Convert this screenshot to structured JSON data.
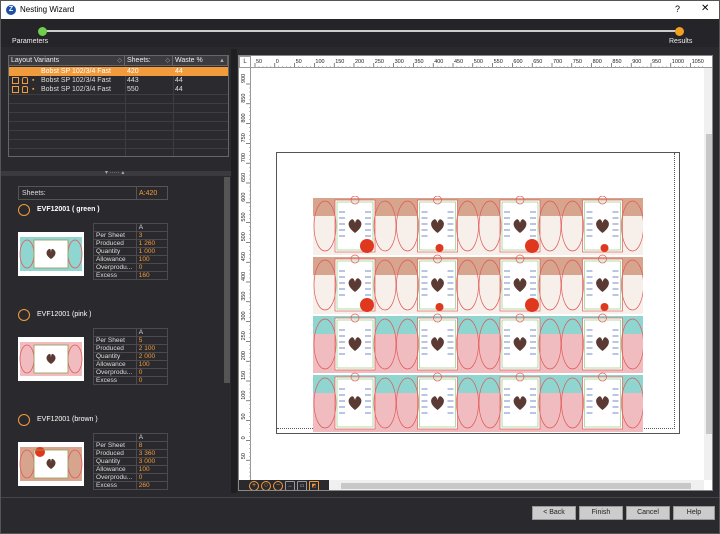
{
  "window": {
    "title": "Nesting Wizard",
    "help": "?",
    "close": "✕"
  },
  "steps": [
    {
      "label": "Parameters",
      "color": "#6ecf4c"
    },
    {
      "label": "Results",
      "color": "#f2a01f"
    }
  ],
  "variants": {
    "columns": [
      "Layout Variants",
      "Sheets:",
      "Waste %"
    ],
    "rows": [
      {
        "name": "Bobst SP 102/3/4 Fast",
        "sheets": "420",
        "waste": "44",
        "selected": true
      },
      {
        "name": "Bobst SP 102/3/4 Fast",
        "sheets": "443",
        "waste": "44",
        "selected": false
      },
      {
        "name": "Bobst SP 102/3/4 Fast",
        "sheets": "550",
        "waste": "44",
        "selected": false
      }
    ]
  },
  "details": {
    "sheets_label": "Sheets:",
    "sheets_value": "A:420",
    "jobs": [
      {
        "name": "EVF12001 ( green )",
        "bold": true,
        "column": "A",
        "stats": [
          [
            "Per Sheet",
            "3"
          ],
          [
            "Produced",
            "1 260"
          ],
          [
            "Quantity",
            "1 000"
          ],
          [
            "Allowance",
            "100"
          ],
          [
            "Overprodu...",
            "0"
          ],
          [
            "Excess",
            "160"
          ]
        ]
      },
      {
        "name": "EVF12001 (pink )",
        "bold": false,
        "column": "A",
        "stats": [
          [
            "Per Sheet",
            "5"
          ],
          [
            "Produced",
            "2 100"
          ],
          [
            "Quantity",
            "2 000"
          ],
          [
            "Allowance",
            "100"
          ],
          [
            "Overprodu...",
            "0"
          ],
          [
            "Excess",
            "0"
          ]
        ]
      },
      {
        "name": "EVF12001 (brown )",
        "bold": false,
        "column": "A",
        "stats": [
          [
            "Per Sheet",
            "8"
          ],
          [
            "Produced",
            "3 360"
          ],
          [
            "Quantity",
            "3 000"
          ],
          [
            "Allowance",
            "100"
          ],
          [
            "Overprodu...",
            "0"
          ],
          [
            "Excess",
            "260"
          ]
        ]
      }
    ]
  },
  "ruler": {
    "corner": "L",
    "top_ticks": [
      "50",
      "0",
      "50",
      "100",
      "150",
      "200",
      "250",
      "300",
      "350",
      "400",
      "450",
      "500",
      "550",
      "600",
      "650",
      "700",
      "750",
      "800",
      "850",
      "900",
      "950",
      "1000",
      "1050"
    ],
    "left_ticks": [
      "900",
      "850",
      "800",
      "750",
      "700",
      "650",
      "600",
      "550",
      "500",
      "450",
      "400",
      "350",
      "300",
      "250",
      "200",
      "150",
      "100",
      "50",
      "0",
      "50"
    ]
  },
  "layout": {
    "rows": [
      {
        "band": "#d7a58e",
        "lines": "#e05a5a"
      },
      {
        "band": "#d7a58e",
        "lines": "#e05a5a"
      },
      {
        "band": "#8fd5d0",
        "lines": "#e05a5a",
        "band2": "#f1bcc0"
      },
      {
        "band": "#8fd5d0",
        "lines": "#e05a5a",
        "band2": "#f1bcc0"
      }
    ],
    "green_line": "#7cc96a",
    "heart_color": "#5a3a32",
    "red_dot": "#e0381e"
  },
  "footer": {
    "back": "< Back",
    "finish": "Finish",
    "cancel": "Cancel",
    "help": "Help"
  },
  "accent": "#f29b3c"
}
